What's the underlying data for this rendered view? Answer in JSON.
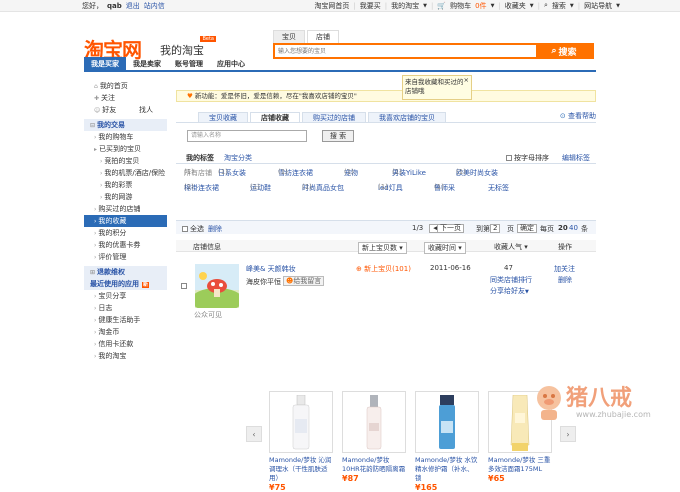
{
  "topbar": {
    "greeting": "您好，",
    "user": "qab",
    "logout": "退出",
    "messages": "站内信",
    "links": [
      "淘宝网首页",
      "我要买",
      "我的淘宝",
      "购物车",
      "0件",
      "收藏夹",
      "搜索",
      "网站导航"
    ]
  },
  "header": {
    "logo": "淘宝网",
    "subtitle": "我的淘宝",
    "beta": "Beta",
    "search_tabs": [
      "宝贝",
      "店铺"
    ],
    "search_placeholder": "输入您想要的宝贝",
    "search_button": "搜索"
  },
  "nav": [
    "我是买家",
    "我是卖家",
    "账号管理",
    "应用中心"
  ],
  "sidebar": {
    "items": [
      {
        "label": "我的首页",
        "type": "link"
      },
      {
        "label": "关注",
        "type": "link"
      },
      {
        "label": "好友",
        "type": "link",
        "extra": "找人"
      },
      {
        "label": "我的交易",
        "type": "header"
      },
      {
        "label": "我的购物车",
        "type": "link"
      },
      {
        "label": "已买到的宝贝",
        "type": "link"
      },
      {
        "label": "竞拍的宝贝",
        "type": "sub"
      },
      {
        "label": "我的机票/酒店/保险",
        "type": "sub"
      },
      {
        "label": "我的彩票",
        "type": "sub"
      },
      {
        "label": "我的网游",
        "type": "sub"
      },
      {
        "label": "购买过的店铺",
        "type": "link"
      },
      {
        "label": "我的收藏",
        "type": "selected"
      },
      {
        "label": "我的积分",
        "type": "link"
      },
      {
        "label": "我的优惠卡券",
        "type": "link"
      },
      {
        "label": "评价管理",
        "type": "link"
      },
      {
        "label": "退款维权",
        "type": "header"
      },
      {
        "label": "最近使用的应用",
        "type": "header2",
        "badge": "新"
      },
      {
        "label": "宝贝分享",
        "type": "link"
      },
      {
        "label": "日志",
        "type": "link"
      },
      {
        "label": "健康生活助手",
        "type": "link"
      },
      {
        "label": "淘金币",
        "type": "link"
      },
      {
        "label": "信用卡还款",
        "type": "link"
      },
      {
        "label": "我的淘宝",
        "type": "link"
      }
    ]
  },
  "main": {
    "notice": "新功能：爱是怀旧，爱是信赖，尽在\"我喜欢店铺的宝贝\"",
    "tip": "来自我收藏和买过的店铺哦",
    "help": "查看帮助",
    "tabs": [
      "宝贝收藏",
      "店铺收藏",
      "购买过的店铺",
      "我喜欢店铺的宝贝"
    ],
    "name_placeholder": "请输入名称",
    "search_button": "搜 索",
    "tag_title": "我的标签",
    "taobao_cat": "淘宝分类",
    "sort_pinyin": "按字母排序",
    "edit_tags": "编辑标签",
    "tags": [
      {
        "label": "所有店铺",
        "count": "(1)"
      },
      {
        "label": "日系女装",
        "count": "(1)"
      },
      {
        "label": "雪纺连衣裙",
        "count": "(1)"
      },
      {
        "label": "宠物",
        "count": "(1)"
      },
      {
        "label": "男装YiLike",
        "count": "(1)"
      },
      {
        "label": "欧美时尚女装",
        "count": "(1)"
      },
      {
        "label": "棉褂连衣裙",
        "count": "(1)"
      },
      {
        "label": "运动鞋",
        "count": "(1)"
      },
      {
        "label": "时尚真品女包",
        "count": "(1)"
      },
      {
        "label": "led灯具",
        "count": "(1)"
      },
      {
        "label": "鲁师采",
        "count": "(1)"
      },
      {
        "label": "无标签",
        "count": ""
      }
    ],
    "toolbar": {
      "select_all": "全选",
      "delete": "删除",
      "page": "1/3",
      "prev": "◀",
      "next": "下一页",
      "goto": "到第",
      "page_input": "2",
      "page_unit": "页",
      "confirm": "确定",
      "per_page": "每页",
      "p20": "20",
      "p40": "40",
      "cond": "条"
    },
    "columns": {
      "shop_info": "店铺信息",
      "new_items": "新上宝贝数",
      "time": "收藏时间",
      "popularity": "收藏人气",
      "action": "操作"
    },
    "shop": {
      "name": "峰美& 天颜韩妆",
      "wangwang": "海皮你平恒",
      "wangwang_status": "给我留言",
      "new_count": "新上宝贝(101)",
      "date": "2011-06-16",
      "popularity": "47",
      "popularity_link": "同类店铺排行",
      "share": "分享给好友",
      "follow": "加关注",
      "delete": "删除",
      "avatar_caption": "公众可见"
    },
    "products": [
      {
        "name": "Mamonde/梦妆 沁润调理水（干性肌肤适用）",
        "price": "75"
      },
      {
        "name": "Mamonde/梦妆 10HR花韵防晒隔离霜",
        "price": "87"
      },
      {
        "name": "Mamonde/梦妆 水饮精水修护霜（补水、锁",
        "price": "165"
      },
      {
        "name": "Mamonde/梦妆 三重多效洁面霜175ML",
        "price": "65"
      }
    ]
  },
  "watermark": {
    "text": "猪八戒",
    "url": "www.zhubajie.com"
  },
  "colors": {
    "accent": "#ff7200",
    "brand": "#ff5500",
    "nav": "#2b6bb6",
    "link": "#2953a6"
  }
}
